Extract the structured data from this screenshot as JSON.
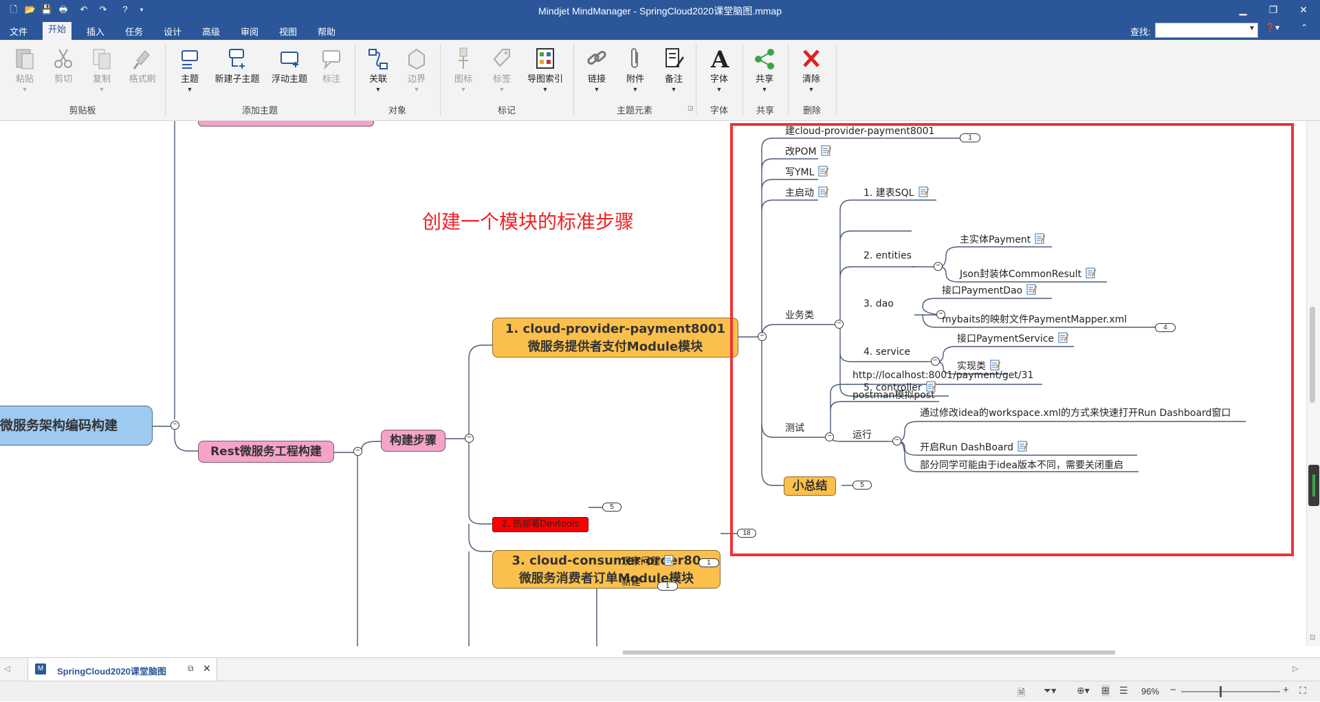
{
  "window": {
    "title": "Mindjet MindManager - SpringCloud2020课堂脑图.mmap"
  },
  "menu": {
    "tabs": [
      "文件",
      "开始",
      "插入",
      "任务",
      "设计",
      "高级",
      "审阅",
      "视图",
      "帮助"
    ],
    "active": "开始",
    "find_label": "查找:"
  },
  "ribbon": {
    "buttons": {
      "paste": "粘贴",
      "cut": "剪切",
      "copy": "复制",
      "format_painter": "格式刷",
      "topic": "主题",
      "new_subtopic": "新建子主题",
      "floating_topic": "浮动主题",
      "callout": "标注",
      "relationship": "关联",
      "boundary": "边界",
      "icon": "图标",
      "tag": "标签",
      "map_index": "导图索引",
      "link": "链接",
      "attachment": "附件",
      "notes": "备注",
      "font": "字体",
      "share": "共享",
      "clear": "清除"
    },
    "groups": {
      "clipboard": "剪贴板",
      "add_topic": "添加主题",
      "objects": "对象",
      "markers": "标记",
      "topic_elements": "主题元素",
      "font": "字体",
      "share": "共享",
      "delete": "删除"
    }
  },
  "map": {
    "annotation": "创建一个模块的标准步骤",
    "central_partial": "、微服务架构编码构建",
    "rest": "Rest微服务工程构建",
    "steps": "构建步骤",
    "s1_line1": "1. cloud-provider-payment8001",
    "s1_line2": "微服务提供者支付Module模块",
    "s2": "2. 热部署Devtools",
    "s2_badge": "5",
    "s3_line1": "3. cloud-consumer-order80",
    "s3_line2": "微服务消费者订单Module模块",
    "s3_badge": "18",
    "observe": "观察问题",
    "observe_badge": "1",
    "newbuild": "新建",
    "newbuild_badge": "1",
    "n_create": "建cloud-provider-payment8001",
    "n_create_badge": "1",
    "n_pom": "改POM",
    "n_yml": "写YML",
    "n_main": "主启动",
    "n_biz": "业务类",
    "b1": "1. 建表SQL",
    "b2": "2. entities",
    "b2a": "主实体Payment",
    "b2b": "Json封装体CommonResult",
    "b3": "3. dao",
    "b3a": "接口PaymentDao",
    "b3b": "mybaits的映射文件PaymentMapper.xml",
    "b3b_badge": "4",
    "b4": "4. service",
    "b4a": "接口PaymentService",
    "b4b": "实现类",
    "b5": "5. controller",
    "n_test": "测试",
    "t1": "http://localhost:8001/payment/get/31",
    "t2": "postman模拟post",
    "t3": "运行",
    "t3a": "通过修改idea的workspace.xml的方式来快速打开Run Dashboard窗口",
    "t3b": "开启Run DashBoard",
    "t3c": "部分同学可能由于idea版本不同，需要关闭重启",
    "summary": "小总结",
    "summary_badge": "5"
  },
  "doc_tab": {
    "name": "SpringCloud2020课堂脑图"
  },
  "status": {
    "zoom": "96%"
  },
  "colors": {
    "accent": "#2b579a",
    "orange_topic": "#fbbf4b",
    "pink_topic": "#f5a3c8",
    "blue_topic": "#9fcaf0",
    "red_topic": "#ff0000",
    "highlight_box": "#ee3333"
  }
}
